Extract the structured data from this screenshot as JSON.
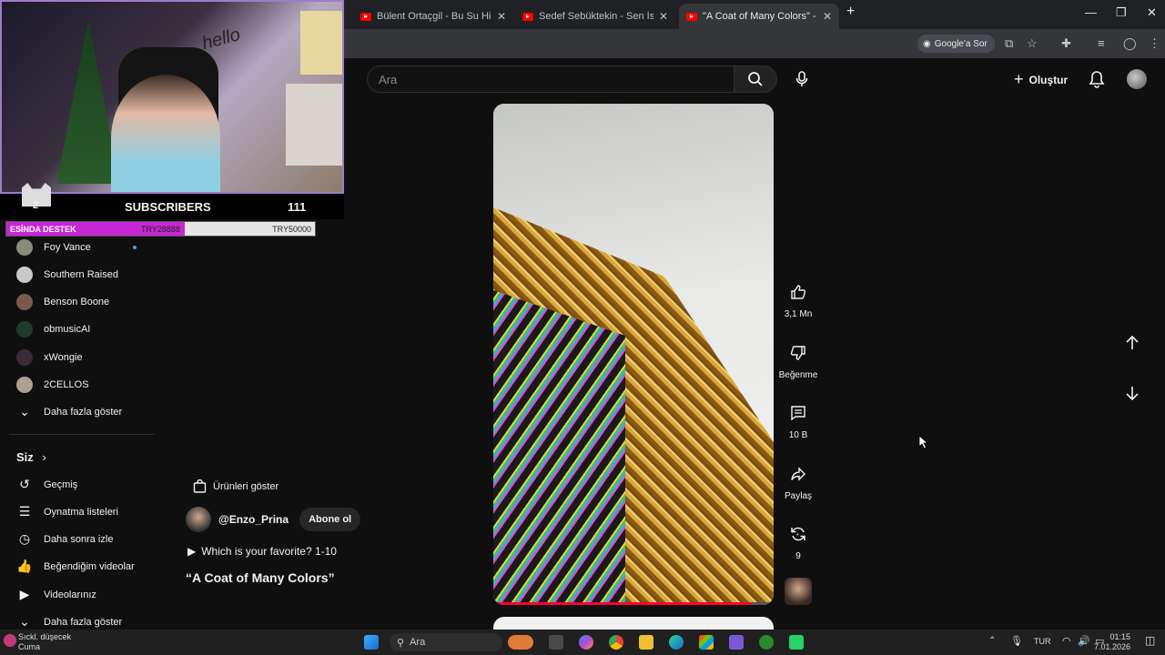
{
  "browser": {
    "tabs": [
      {
        "title": "Bülent Ortaçgil - Bu Su Hiç Dur",
        "active": false
      },
      {
        "title": "Sedef Sebüktekin - Sen İstersin",
        "active": false
      },
      {
        "title": "\"A Coat of Many Colors\" - YouTu",
        "active": true
      }
    ],
    "new_tab_icon": "plus-icon",
    "google_ask": "Google'a Sor",
    "window_controls": [
      "minimize-icon",
      "restore-icon",
      "close-icon"
    ]
  },
  "youtube": {
    "search_placeholder": "Ara",
    "create_label": "Oluştur"
  },
  "stream_overlay": {
    "hello_text": "hello",
    "subs_number": "2",
    "subs_label": "SUBSCRIBERS",
    "subs_count": "111",
    "goal": {
      "label": "ESİNDA DESTEK",
      "current": "TRY28888",
      "target": "TRY50000",
      "fill_fraction": 0.578
    }
  },
  "sidebar": {
    "subscriptions": [
      {
        "name": "Foy Vance",
        "new": true,
        "color": "#8a8a7a"
      },
      {
        "name": "Southern Raised",
        "new": false,
        "color": "#c9c9c9"
      },
      {
        "name": "Benson Boone",
        "new": false,
        "color": "#7a5a4a"
      },
      {
        "name": "obmusicAI",
        "new": false,
        "color": "#1e3a2a"
      },
      {
        "name": "xWongie",
        "new": false,
        "color": "#3a2a3a"
      },
      {
        "name": "2CELLOS",
        "new": false,
        "color": "#b0a090"
      }
    ],
    "show_more_1": "Daha fazla göster",
    "you_section": "Siz",
    "you_items": [
      {
        "label": "Geçmiş",
        "icon": "history-icon",
        "glyph": "↺"
      },
      {
        "label": "Oynatma listeleri",
        "icon": "playlists-icon",
        "glyph": "☰"
      },
      {
        "label": "Daha sonra izle",
        "icon": "watch-later-icon",
        "glyph": "◷"
      },
      {
        "label": "Beğendiğim videolar",
        "icon": "like-icon",
        "glyph": "👍"
      },
      {
        "label": "Videolarınız",
        "icon": "your-videos-icon",
        "glyph": "▶"
      }
    ],
    "show_more_2": "Daha fazla göster"
  },
  "short": {
    "products_label": "Ürünleri göster",
    "channel": "@Enzo_Prina",
    "subscribe_label": "Abone ol",
    "playlist_label": "Which is your favorite? 1-10",
    "title": "“A Coat of Many Colors”",
    "progress_fraction": 0.92,
    "actions": {
      "likes": "3,1 Mn",
      "dislike": "Beğenme",
      "comments": "10 B",
      "share": "Paylaş",
      "remix": "9"
    }
  },
  "taskbar": {
    "weather_title": "Sıckl. düşecek",
    "weather_sub": "Cuma",
    "search_label": "Ara",
    "language": "TUR",
    "time": "01:15",
    "date": "7.01.2026"
  }
}
